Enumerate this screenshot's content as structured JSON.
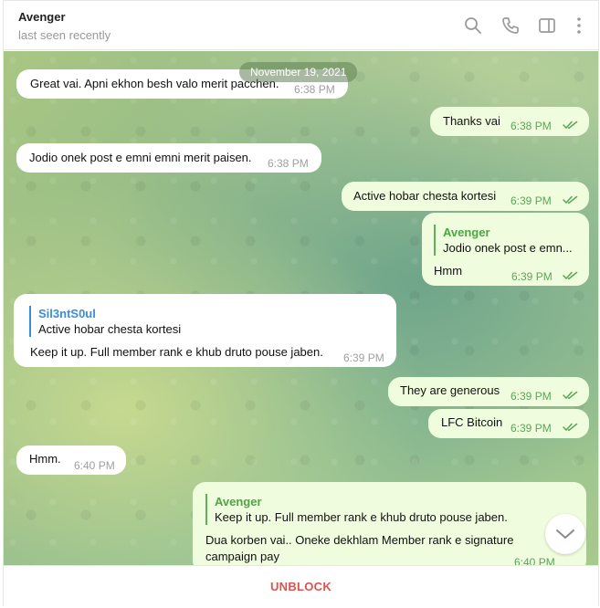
{
  "header": {
    "name": "Avenger",
    "status": "last seen recently",
    "icons": [
      "search-icon",
      "phone-icon",
      "sidebar-icon",
      "more-vertical-icon"
    ]
  },
  "date_label": "November 19, 2021",
  "messages": [
    {
      "dir": "in",
      "text": "Great vai. Apni ekhon besh valo merit pacchen.",
      "time": "6:38 PM"
    },
    {
      "dir": "out",
      "text": "Thanks vai",
      "time": "6:38 PM",
      "read": true
    },
    {
      "dir": "in",
      "text": "Jodio onek post e emni emni merit paisen.",
      "time": "6:38 PM"
    },
    {
      "dir": "out",
      "text": "Active hobar chesta kortesi",
      "time": "6:39 PM",
      "read": true
    },
    {
      "dir": "out",
      "reply": {
        "name": "Avenger",
        "text": "Jodio onek post e emn..."
      },
      "text": "Hmm",
      "time": "6:39 PM",
      "read": true
    },
    {
      "dir": "in",
      "reply": {
        "name": "Sil3ntS0ul",
        "text": "Active hobar chesta kortesi"
      },
      "text": "Keep it up. Full member rank e khub druto pouse jaben.",
      "time": "6:39 PM"
    },
    {
      "dir": "out",
      "text": "They are generous",
      "time": "6:39 PM",
      "read": true
    },
    {
      "dir": "out",
      "text": "LFC Bitcoin",
      "time": "6:39 PM",
      "read": true
    },
    {
      "dir": "in",
      "text": "Hmm.",
      "time": "6:40 PM"
    },
    {
      "dir": "out",
      "reply": {
        "name": "Avenger",
        "text": "Keep it up. Full member rank e khub druto pouse jaben."
      },
      "text_line1": "Dua korben vai.. Oneke dekhlam Member rank e signature",
      "text_line2": "campaign pay",
      "time": "6:40 PM",
      "read": true
    }
  ],
  "scroll_button_icon": "chevron-down-icon",
  "bottom": {
    "action_label": "UNBLOCK"
  },
  "colors": {
    "incoming_bubble": "#ffffff",
    "outgoing_bubble": "#effdde",
    "outgoing_time": "#5ea459",
    "reply_in_accent": "#3a8ed6",
    "reply_out_accent": "#4fa446",
    "unblock": "#d9534f"
  }
}
